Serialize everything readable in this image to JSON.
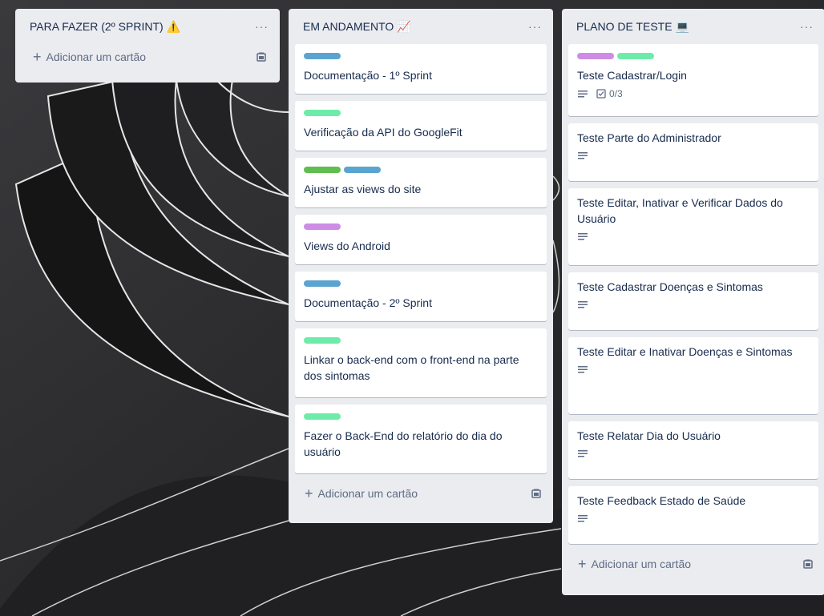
{
  "colors": {
    "blue": "#5ba4cf",
    "green": "#61bd4f",
    "mint": "#6deca9",
    "purple": "#cd8de5"
  },
  "lists": [
    {
      "title": "PARA FAZER (2º SPRINT)",
      "emoji": "⚠️",
      "menu": "···",
      "add_label": "Adicionar um cartão",
      "cards": []
    },
    {
      "title": "EM ANDAMENTO",
      "emoji": "📈",
      "menu": "···",
      "add_label": "Adicionar um cartão",
      "cards": [
        {
          "labels": [
            "blue"
          ],
          "title": "Documentação - 1º Sprint"
        },
        {
          "labels": [
            "mint"
          ],
          "title": "Verificação da API do GoogleFit"
        },
        {
          "labels": [
            "green",
            "blue"
          ],
          "title": "Ajustar as views do site"
        },
        {
          "labels": [
            "purple"
          ],
          "title": "Views do Android"
        },
        {
          "labels": [
            "blue"
          ],
          "title": "Documentação - 2º Sprint"
        },
        {
          "labels": [
            "mint"
          ],
          "title": "Linkar o back-end com o front-end na parte dos sintomas"
        },
        {
          "labels": [
            "mint"
          ],
          "title": "Fazer o Back-End do relatório do dia do usuário"
        }
      ]
    },
    {
      "title": "PLANO DE TESTE",
      "emoji": "💻",
      "menu": "···",
      "add_label": "Adicionar um cartão",
      "cards": [
        {
          "labels": [
            "purple",
            "mint"
          ],
          "title": "Teste Cadastrar/Login",
          "description": true,
          "checklist": "0/3"
        },
        {
          "labels": [],
          "title": "Teste Parte do Administrador",
          "description": true
        },
        {
          "labels": [],
          "title": "Teste Editar, Inativar e Verificar Dados do Usuário",
          "description": true
        },
        {
          "labels": [],
          "title": "Teste Cadastrar Doenças e Sintomas",
          "description": true
        },
        {
          "labels": [],
          "title": "Teste Editar e Inativar Doenças e Sintomas",
          "description": true
        },
        {
          "labels": [],
          "title": "Teste Relatar Dia do Usuário",
          "description": true
        },
        {
          "labels": [],
          "title": "Teste Feedback Estado de Saúde",
          "description": true
        }
      ]
    }
  ]
}
